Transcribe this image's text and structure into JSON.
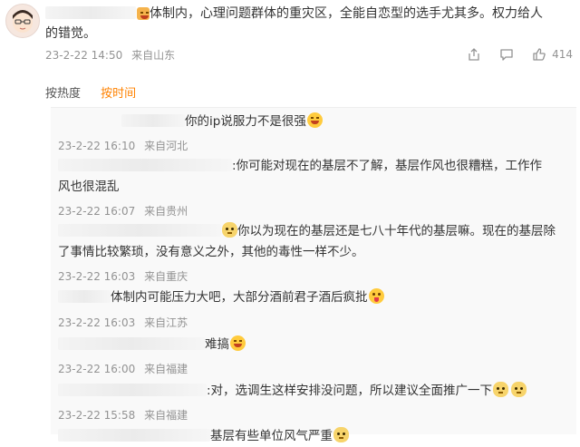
{
  "post": {
    "text_line1": "体制内，心理问题群体的重灾区，全能自恋型的选手尤其多。权力给人",
    "text_line2": "的错觉。",
    "date": "23-2-22 14:50",
    "location": "来自山东",
    "like_count": "414",
    "icons": [
      "share-icon",
      "comment-icon",
      "like-icon"
    ]
  },
  "sort": {
    "by_hot": "按热度",
    "by_time": "按时间",
    "active": "by_time"
  },
  "replies": [
    {
      "text": "你的ip说服力不是很强",
      "emoji": "laugh",
      "date": "23-2-22 16:10",
      "location": "来自河北"
    },
    {
      "text": ":你可能对现在的基层不了解，基层作风也很糟糕，工作作",
      "text2": "风也很混乱",
      "date": "23-2-22 16:07",
      "location": "来自贵州"
    },
    {
      "text": "你以为现在的基层还是七八十年代的基层嘛。现在的基层除",
      "text2": "了事情比较繁琐，没有意义之外，其他的毒性一样不少。",
      "emoji": "cat",
      "date": "23-2-22 16:03",
      "location": "来自重庆"
    },
    {
      "text": "体制内可能压力大吧，大部分酒前君子酒后疯批",
      "emoji": "tongue",
      "date": "23-2-22 16:03",
      "location": "来自江苏"
    },
    {
      "text": "难搞",
      "emoji": "laugh",
      "date": "23-2-22 16:00",
      "location": "来自福建"
    },
    {
      "text": ":对，选调生这样安排没问题，所以建议全面推广一下",
      "emoji": "cat",
      "date": "23-2-22 15:58",
      "location": "来自福建"
    },
    {
      "text": "基层有些单位风气严重",
      "emoji": "cat"
    }
  ],
  "colors": {
    "accent": "#ff8200",
    "meta": "#939393",
    "text": "#333333",
    "reply_bg": "#f9f9f9"
  }
}
